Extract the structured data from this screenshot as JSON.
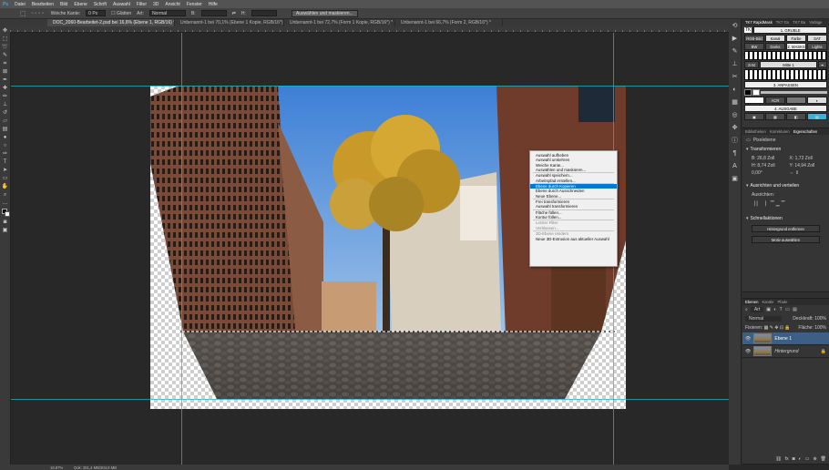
{
  "menubar": {
    "items": [
      "Datei",
      "Bearbeiten",
      "Bild",
      "Ebene",
      "Schrift",
      "Auswahl",
      "Filter",
      "3D",
      "Ansicht",
      "Fenster",
      "Hilfe"
    ]
  },
  "options": {
    "feather_label": "Weiche Kante:",
    "feather_value": "0 Px",
    "style_label": "Art:",
    "style_value": "Normal",
    "width_label": "B:",
    "height_label": "H:",
    "select_mask_label": "Auswählen und maskieren..."
  },
  "tabs": [
    {
      "label": "DOC_2060-Bearbeitet-2.psd bei 16,6% (Ebene 1, RGB/16) *",
      "active": true
    },
    {
      "label": "Unbenannt-1 bei 70,1% (Ebene 1 Kopie, RGB/16*) *",
      "active": false
    },
    {
      "label": "Unbenannt-1 bei 72,7% (Form 1 Kopie, RGB/16*) *",
      "active": false
    },
    {
      "label": "Unbenannt-1 bei 66,7% (Form 2, RGB/16*) *",
      "active": false
    }
  ],
  "plugin": {
    "title": "TK7 Go",
    "rows": [
      [
        "Norm",
        "Fill",
        "Farbe",
        "Hell"
      ],
      [
        "Lum Hi",
        "Mitte",
        "Sehr",
        "Hell"
      ],
      [
        "Bild mpl",
        "",
        "Größe",
        ""
      ],
      [
        "Neuber",
        "",
        "Anwdnl",
        ""
      ],
      [
        "Kontur",
        "",
        "Fläche",
        ""
      ],
      [
        "Dash",
        "ACR",
        "RGB",
        "HP"
      ],
      [
        "Umkehren",
        "",
        "Auswahl",
        ""
      ],
      [
        "A & M",
        "",
        "Speichern",
        ""
      ]
    ],
    "web_label": "Web",
    "web_value": "2560",
    "px_label": "px",
    "marc_label": "Marc",
    "marc_value": "800",
    "fit_label": "Fit",
    "web_sharpen_label": "Web-Schärfen",
    "extra_label": "Extra Schärf",
    "other_label": "Andere"
  },
  "context_menu": {
    "items": [
      {
        "label": "Auswahl aufheben",
        "state": "normal"
      },
      {
        "label": "Auswahl umkehren",
        "state": "normal"
      },
      {
        "label": "Weiche Kante...",
        "state": "normal"
      },
      {
        "label": "Auswählen und maskieren...",
        "state": "normal"
      },
      {
        "sep": true
      },
      {
        "label": "Auswahl speichern...",
        "state": "normal"
      },
      {
        "label": "Arbeitspfad erstellen...",
        "state": "normal"
      },
      {
        "sep": true
      },
      {
        "label": "Ebene durch Kopieren",
        "state": "selected"
      },
      {
        "label": "Ebene durch Ausschneiden",
        "state": "normal"
      },
      {
        "label": "Neue Ebene...",
        "state": "normal"
      },
      {
        "sep": true
      },
      {
        "label": "Frei transformieren",
        "state": "normal"
      },
      {
        "label": "Auswahl transformieren",
        "state": "normal"
      },
      {
        "sep": true
      },
      {
        "label": "Fläche füllen...",
        "state": "normal"
      },
      {
        "label": "Kontur füllen...",
        "state": "normal"
      },
      {
        "sep": true
      },
      {
        "label": "Letzter Filter",
        "state": "disabled"
      },
      {
        "label": "Verblassen...",
        "state": "disabled"
      },
      {
        "sep": true
      },
      {
        "label": "3D-Ebene rendern",
        "state": "disabled"
      },
      {
        "label": "Neue 3D-Extrusion aus aktueller Auswahl",
        "state": "normal"
      }
    ]
  },
  "right": {
    "top_tabs": [
      "TK7 RapidMask",
      "TK7 Go",
      "TK7 Ba",
      "Vorlage",
      "Reisge"
    ],
    "sections": {
      "gruble": "1. GRUBLE",
      "masks": "2. MASKS",
      "adjust": "3. ANPASSEN",
      "output": "4. AUSGABE"
    },
    "row1": [
      "RGB-Bild",
      "Kanal",
      "Farbe",
      "SAT"
    ],
    "row2": [
      "BW",
      "Darks",
      "",
      "Lights"
    ],
    "zone_label": "Zone",
    "mittel_label": "Mitte 1",
    "sm_label": "S-M",
    "acr_label": "ACR",
    "prop_tabs": [
      "Bibliotheken",
      "Korrekturen",
      "Eigenschaften"
    ],
    "pixel_layer_label": "Pixelebene",
    "transform_label": "Transformieren",
    "w_value": "B: 26,8 Zoll",
    "x_value": "X: 1,72 Zoll",
    "h_value": "H: 8,74 Zoll",
    "y_value": "Y: 14,94 Zoll",
    "angle_value": "0,00°",
    "align_label": "Ausrichten und verteilen",
    "align_sub": "Ausrichten:",
    "quick_label": "Schnellaktionen",
    "remove_bg": "Hintergrund entfernen",
    "select_subject": "Motiv auswählen",
    "layers_tabs": [
      "Ebenen",
      "Kanäle",
      "Pfade"
    ],
    "kind_label": "Art",
    "blend_mode": "Normal",
    "opacity_label": "Deckkraft:",
    "opacity_value": "100%",
    "lock_label": "Fixieren:",
    "fill_label": "Fläche:",
    "fill_value": "100%",
    "layers": [
      {
        "name": "Ebene 1",
        "active": true
      },
      {
        "name": "Hintergrund",
        "active": false
      }
    ]
  },
  "status": {
    "zoom": "16,67%",
    "doc": "Dok: 281,4 MB/204,8 MB"
  }
}
